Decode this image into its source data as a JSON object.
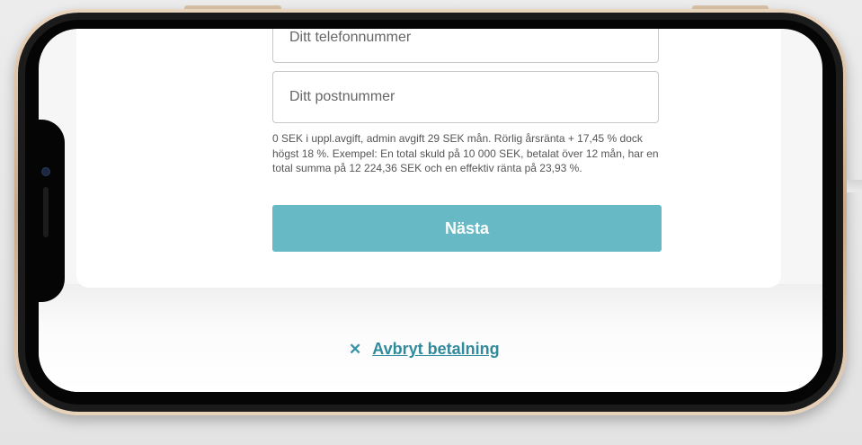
{
  "form": {
    "phone_placeholder": "Ditt telefonnummer",
    "postal_placeholder": "Ditt postnummer",
    "disclaimer": "0 SEK i uppl.avgift, admin avgift 29 SEK mån. Rörlig årsränta + 17,45 % dock högst 18 %. Exempel: En total skuld på 10 000 SEK, betalat över 12 mån, har en total summa på 12 224,36 SEK och en effektiv ränta på 23,93 %.",
    "next_label": "Nästa"
  },
  "footer": {
    "cancel_icon": "close-icon",
    "cancel_label": "Avbryt betalning"
  },
  "colors": {
    "accent": "#66b9c5",
    "link": "#2f8a9b",
    "phone_frame": "#caa987"
  }
}
